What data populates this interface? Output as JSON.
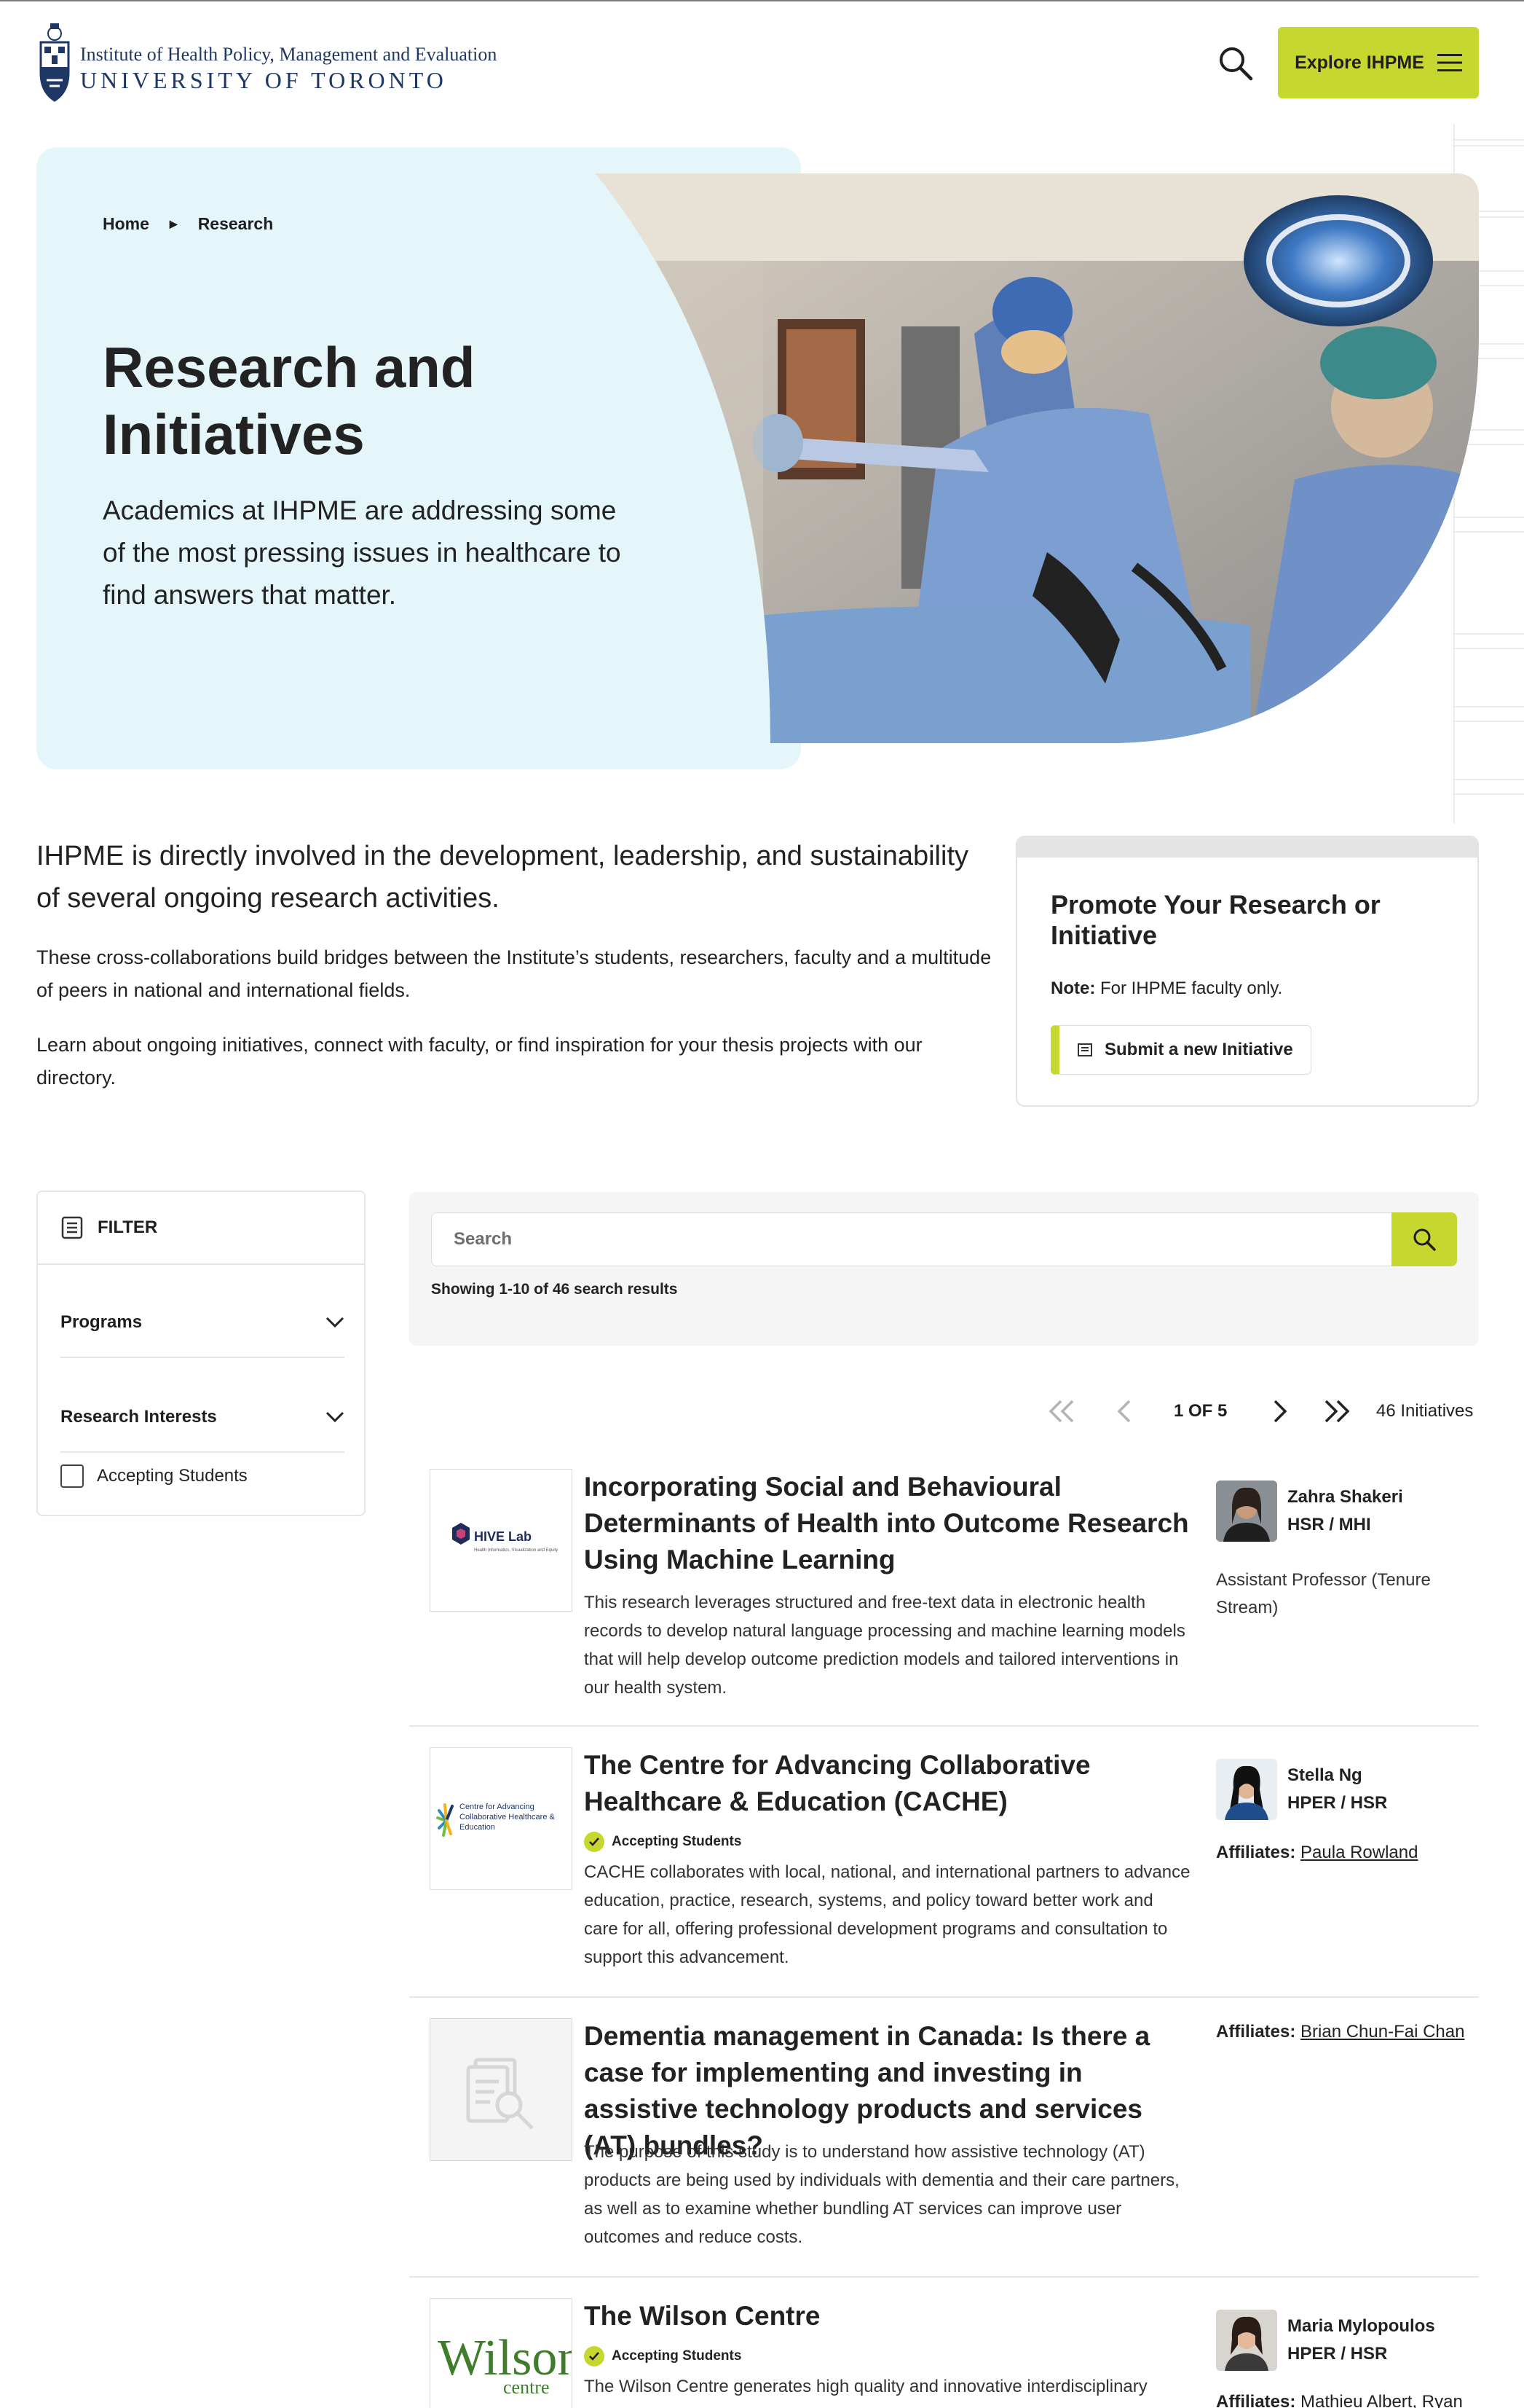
{
  "header": {
    "logo_line1": "Institute of Health Policy, Management and Evaluation",
    "logo_line2": "UNIVERSITY OF TORONTO",
    "explore_label": "Explore IHPME"
  },
  "breadcrumb": {
    "home": "Home",
    "current": "Research"
  },
  "hero": {
    "title": "Research and Initiatives",
    "subtitle": "Academics at IHPME are addressing some of the most pressing issues in healthcare to find answers that matter."
  },
  "intro": {
    "lead": "IHPME is directly involved in the development, leadership, and sustainability of several ongoing research activities.",
    "p1": "These cross-collaborations build bridges between the Institute’s students, researchers, faculty and a multitude of peers in national and international fields.",
    "p2": "Learn about ongoing initiatives, connect with faculty, or find inspiration for your thesis projects with our directory."
  },
  "promote": {
    "title": "Promote Your Research or Initiative",
    "note_label": "Note:",
    "note_text": "For IHPME faculty only.",
    "button_label": "Submit a new Initiative"
  },
  "filter": {
    "title": "FILTER",
    "programs": "Programs",
    "research_interests": "Research Interests",
    "accepting_students": "Accepting Students"
  },
  "search": {
    "placeholder": "Search",
    "results_text": "Showing 1-10 of 46 search results"
  },
  "pagination": {
    "page_label": "1 OF 5",
    "total": "46 Initiatives"
  },
  "results": [
    {
      "title": "Incorporating Social and Behavioural Determinants of Health into Outcome Research Using Machine Learning",
      "description": "This research leverages structured and free-text data in electronic health records to develop natural language processing and machine learning models that will help develop outcome prediction models and tailored interventions in our health system.",
      "logo_text": "HIVE Lab",
      "logo_subtext": "Health Informatics, Visualization and Equity",
      "person_name": "Zahra Shakeri",
      "person_dept": "HSR / MHI",
      "person_role": "Assistant Professor (Tenure Stream)"
    },
    {
      "title": "The Centre for Advancing Collaborative Healthcare & Education (CACHE)",
      "badge": "Accepting Students",
      "description": "CACHE collaborates with local, national, and international partners to advance education, practice, research, systems, and policy toward better work and care for all, offering professional development programs and consultation to support this advancement.",
      "logo_text": "Centre for Advancing Collaborative Healthcare & Education",
      "person_name": "Stella Ng",
      "person_dept": "HPER / HSR",
      "affiliates_label": "Affiliates:",
      "affiliates": "Paula Rowland"
    },
    {
      "title": "Dementia management in Canada: Is there a case for implementing and investing in assistive technology products and services (AT) bundles?",
      "description": "The purpose of this study is to understand how assistive technology (AT) products are being used by individuals with dementia and their care partners, as well as to examine whether bundling AT services can improve user outcomes and reduce costs.",
      "affiliates_label": "Affiliates:",
      "affiliates": "Brian Chun-Fai Chan"
    },
    {
      "title": "The Wilson Centre",
      "badge": "Accepting Students",
      "description": "The Wilson Centre generates high quality and innovative interdisciplinary",
      "logo_text": "Wilson",
      "logo_subtext": "centre",
      "person_name": "Maria Mylopoulos",
      "person_dept": "HPER / HSR",
      "affiliates_label": "Affiliates:",
      "affiliates": "Mathieu Albert",
      "affiliates2": "Ryan"
    }
  ],
  "colors": {
    "accent": "#c6d72f",
    "hero_bg": "#e5f6fa",
    "uoft_navy": "#1e3765"
  }
}
